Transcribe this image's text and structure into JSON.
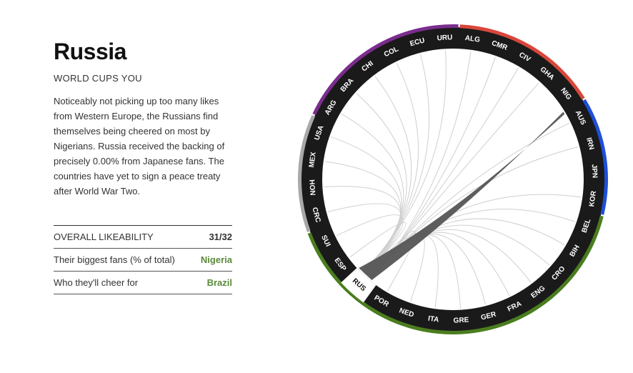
{
  "country": {
    "name": "Russia",
    "subtitle": "WORLD CUPS YOU",
    "description": "Noticeably not picking up too many likes from Western Europe, the Russians find themselves being cheered on most by Nigerians. Russia received the backing of precisely 0.00% from Japanese fans. The countries have yet to sign a peace treaty after World War Two."
  },
  "stats": [
    {
      "label": "OVERALL LIKEABILITY",
      "value": "31/32",
      "highlight": false
    },
    {
      "label": "Their biggest fans (% of total)",
      "value": "Nigeria",
      "highlight": true
    },
    {
      "label": "Who they'll cheer for",
      "value": "Brazil",
      "highlight": true
    }
  ],
  "wheel": {
    "teams": [
      "URU",
      "ALG",
      "CMR",
      "CIV",
      "GHA",
      "NIG",
      "AUS",
      "IRN",
      "JPN",
      "KOR",
      "BEL",
      "BIH",
      "CRO",
      "ENG",
      "FRA",
      "GER",
      "GRE",
      "ITA",
      "NED",
      "POR",
      "RUS",
      "ESP",
      "SUI",
      "CRC",
      "HON",
      "MEX",
      "USA",
      "ARG",
      "BRA",
      "CHI",
      "COL",
      "ECU"
    ],
    "selected": "RUS",
    "confederations": [
      {
        "color": "#d9473b",
        "teams": [
          "ALG",
          "CMR",
          "CIV",
          "GHA",
          "NIG"
        ]
      },
      {
        "color": "#1e4fd8",
        "teams": [
          "AUS",
          "IRN",
          "JPN",
          "KOR"
        ]
      },
      {
        "color": "#4a7d1f",
        "teams": [
          "BEL",
          "BIH",
          "CRO",
          "ENG",
          "FRA",
          "GER",
          "GRE",
          "ITA",
          "NED",
          "POR",
          "RUS",
          "ESP",
          "SUI"
        ]
      },
      {
        "color": "#a8a8a8",
        "teams": [
          "CRC",
          "HON",
          "MEX",
          "USA"
        ]
      },
      {
        "color": "#7b2d8e",
        "teams": [
          "ARG",
          "BRA",
          "CHI",
          "COL",
          "ECU",
          "URU"
        ]
      }
    ],
    "highlight_chord": "NIG",
    "colors": {
      "ring": "#1a1a1a",
      "label": "#ffffff",
      "selected_bg": "#ffffff",
      "selected_text": "#111111",
      "chord_main": "#555555",
      "chord_light": "#cfcfcf"
    }
  }
}
